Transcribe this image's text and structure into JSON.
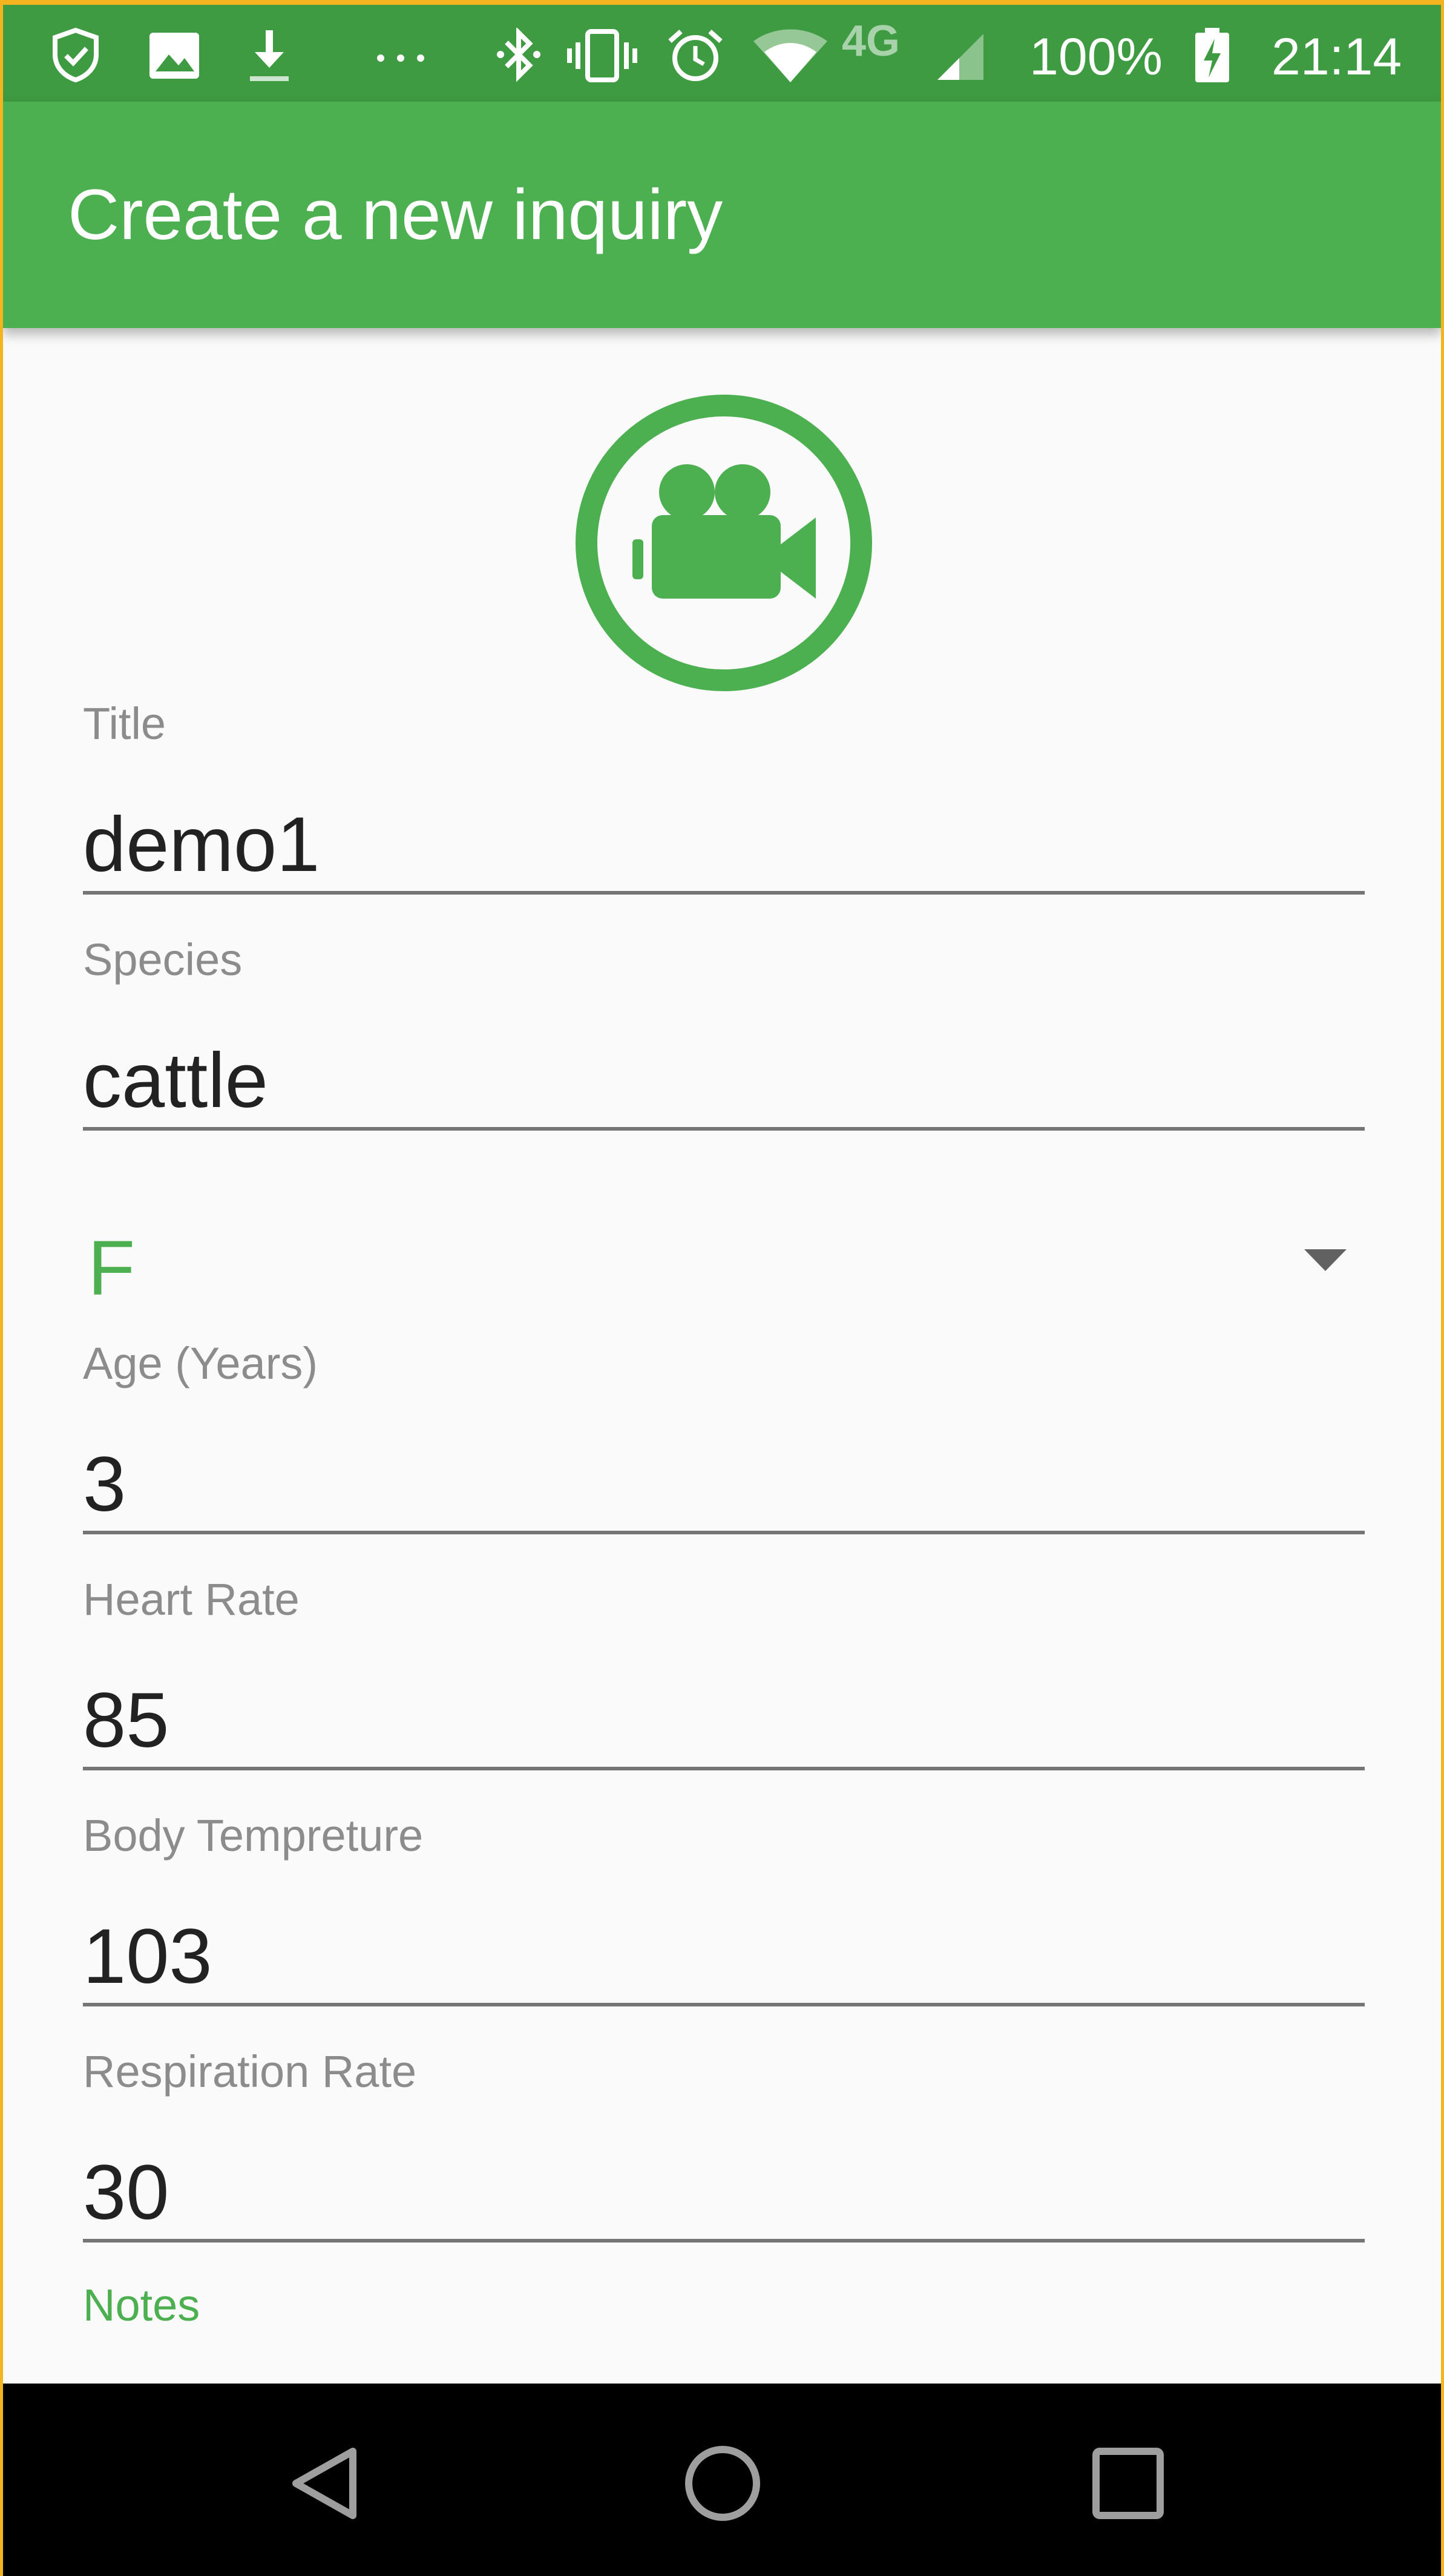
{
  "status_bar": {
    "icons": [
      "shield-check-icon",
      "image-icon",
      "download-icon",
      "more-dots-icon",
      "bluetooth-icon",
      "vibrate-icon",
      "alarm-icon",
      "wifi-icon",
      "4g-lte-icon",
      "signal-icon",
      "battery-charging-icon"
    ],
    "battery": "100%",
    "time": "21:14",
    "network_label": "4G"
  },
  "app_bar": {
    "title": "Create a new inquiry"
  },
  "media": {
    "icon": "video-camera-icon",
    "color": "#4caf50"
  },
  "form": {
    "title": {
      "label": "Title",
      "value": "demo1"
    },
    "species": {
      "label": "Species",
      "value": "cattle"
    },
    "gender": {
      "value": "F"
    },
    "age": {
      "label": "Age (Years)",
      "value": "3"
    },
    "heart_rate": {
      "label": "Heart Rate",
      "value": "85"
    },
    "body_temperature": {
      "label": "Body Tempreture",
      "value": "103"
    },
    "respiration_rate": {
      "label": "Respiration Rate",
      "value": "30"
    },
    "notes": {
      "label": "Notes"
    }
  },
  "nav_bar": {
    "buttons": [
      "back-icon",
      "home-icon",
      "recents-icon"
    ]
  },
  "colors": {
    "primary": "#4caf50",
    "primary_dark": "#3e9b41",
    "background": "#fafafa",
    "label": "#8c8c8c",
    "text": "#222222"
  }
}
